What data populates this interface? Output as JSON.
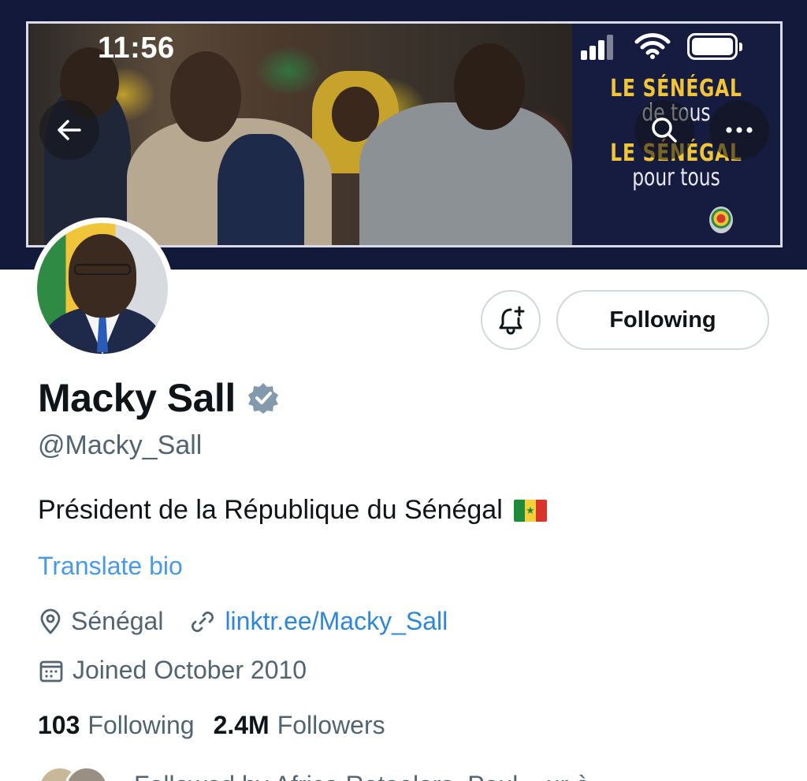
{
  "status_bar": {
    "time": "11:56"
  },
  "banner": {
    "slogan_line1": "LE SÉNÉGAL",
    "slogan_line2": "de tous",
    "slogan_line3": "LE SÉNÉGAL",
    "slogan_line4": "pour tous"
  },
  "nav": {
    "back_icon": "arrow-left-icon",
    "search_icon": "search-icon",
    "more_icon": "more-icon"
  },
  "actions": {
    "notify_icon": "bell-plus-icon",
    "follow_label": "Following"
  },
  "profile": {
    "name": "Macky Sall",
    "verified": true,
    "handle": "@Macky_Sall",
    "bio": "Président de la République du Sénégal",
    "translate_label": "Translate bio",
    "location": "Sénégal",
    "link": "linktr.ee/Macky_Sall",
    "joined": "Joined October 2010"
  },
  "stats": {
    "following_count": "103",
    "following_label": "Following",
    "followers_count": "2.4M",
    "followers_label": "Followers"
  },
  "followed_by": {
    "text": "Followed by Africa Retaelers, Paul ...ur è"
  },
  "colors": {
    "accent": "#1d9bf0",
    "link": "#2f86d6",
    "muted": "#536471",
    "banner_bg": "#12193a",
    "slogan_gold": "#f0c53a"
  }
}
